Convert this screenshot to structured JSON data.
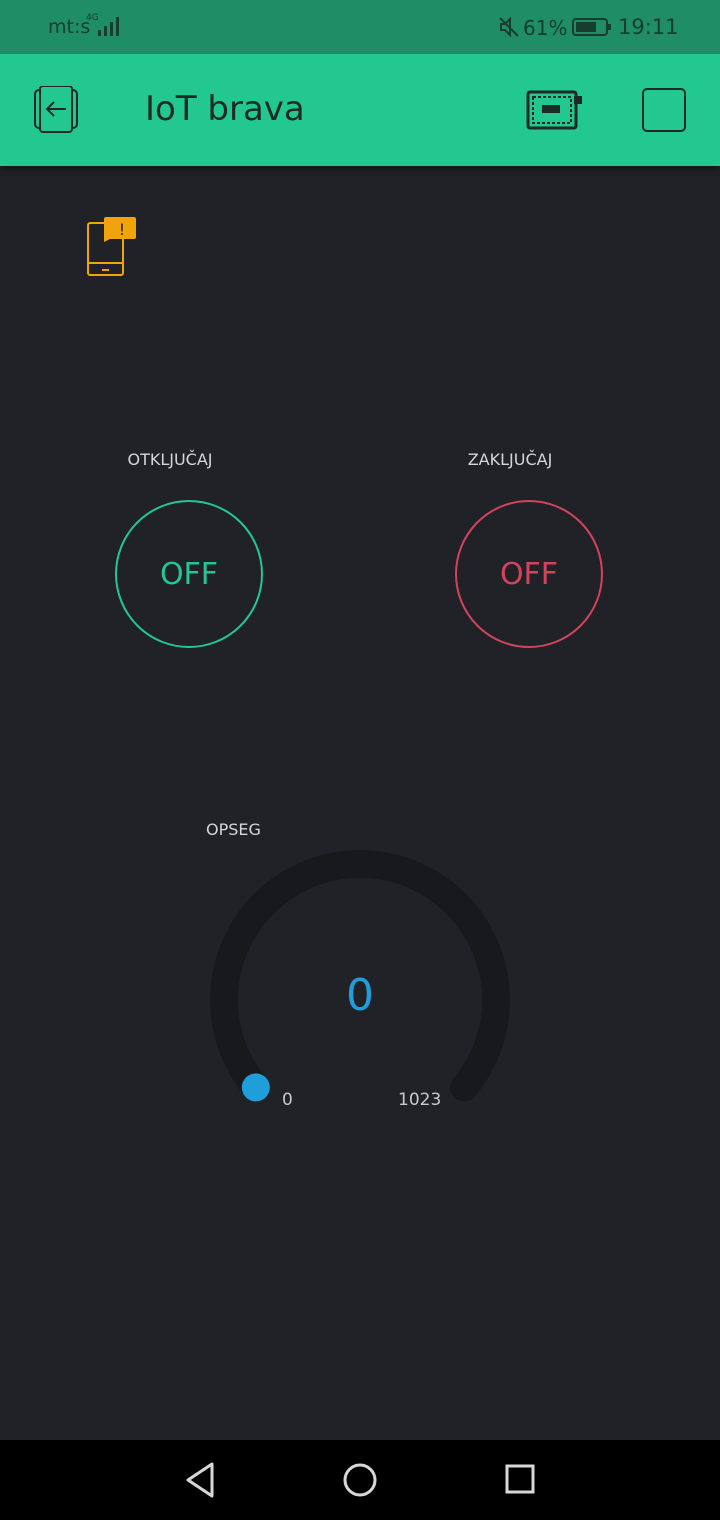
{
  "status_bar": {
    "carrier": "mt:s",
    "network": "4G",
    "battery_percent": "61%",
    "time": "19:11",
    "icons": [
      "signal-icon",
      "mute-icon",
      "battery-icon"
    ]
  },
  "app_bar": {
    "title": "IoT brava",
    "icons": [
      "exit-icon",
      "device-board-icon",
      "play-stop-icon"
    ],
    "background_color": "#23c890"
  },
  "status_indicator": {
    "icon": "device-offline-warning-icon",
    "color": "#f0a30a"
  },
  "widgets": {
    "unlock": {
      "label": "OTKLJUČAJ",
      "state": "OFF",
      "color": "#23c890"
    },
    "lock": {
      "label": "ZAKLJUČAJ",
      "state": "OFF",
      "color": "#d3435c"
    },
    "gauge": {
      "label": "OPSEG",
      "value": "0",
      "min": "0",
      "max": "1023",
      "level": 0,
      "color": "#1e9fd9"
    }
  },
  "nav_bar": {
    "icons": [
      "nav-back-icon",
      "nav-home-icon",
      "nav-recents-icon"
    ]
  }
}
